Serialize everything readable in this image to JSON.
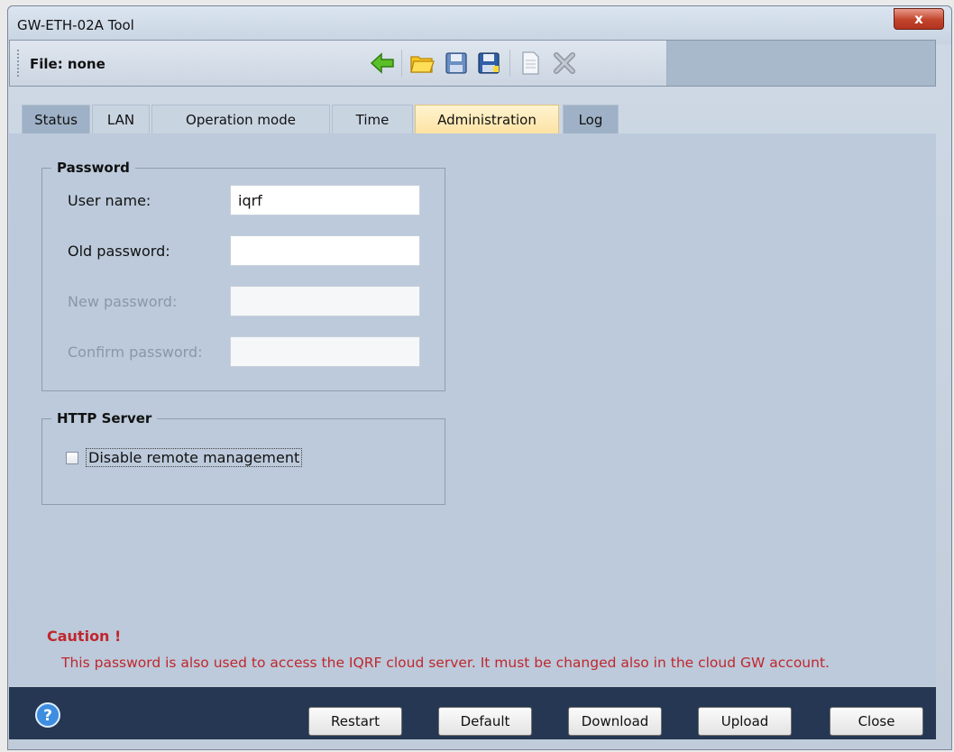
{
  "window": {
    "title": "GW-ETH-02A Tool",
    "close_label": "x"
  },
  "toolbar": {
    "file_label": "File: none",
    "icons": [
      "back-arrow-icon",
      "open-folder-icon",
      "save-icon",
      "save-as-icon",
      "document-icon",
      "delete-icon"
    ]
  },
  "tabs": [
    {
      "label": "Status"
    },
    {
      "label": "LAN"
    },
    {
      "label": "Operation mode"
    },
    {
      "label": "Time"
    },
    {
      "label": "Administration"
    },
    {
      "label": "Log"
    }
  ],
  "active_tab": "Administration",
  "password_group": {
    "legend": "Password",
    "user_name_label": "User name:",
    "user_name_value": "iqrf",
    "old_password_label": "Old password:",
    "old_password_value": "",
    "new_password_label": "New password:",
    "new_password_value": "",
    "confirm_password_label": "Confirm password:",
    "confirm_password_value": ""
  },
  "http_group": {
    "legend": "HTTP Server",
    "disable_remote_label": "Disable remote management",
    "disable_remote_checked": false
  },
  "caution": {
    "title": "Caution !",
    "text": "This password is also used to access the IQRF cloud server. It must be changed also in the cloud GW account."
  },
  "buttons": {
    "restart": "Restart",
    "default": "Default",
    "download": "Download",
    "upload": "Upload",
    "close": "Close"
  },
  "colors": {
    "panel_bg": "#bccadb",
    "active_tab": "#fde3a4",
    "caution_red": "#c0272d",
    "bottom_bar": "#253752"
  }
}
